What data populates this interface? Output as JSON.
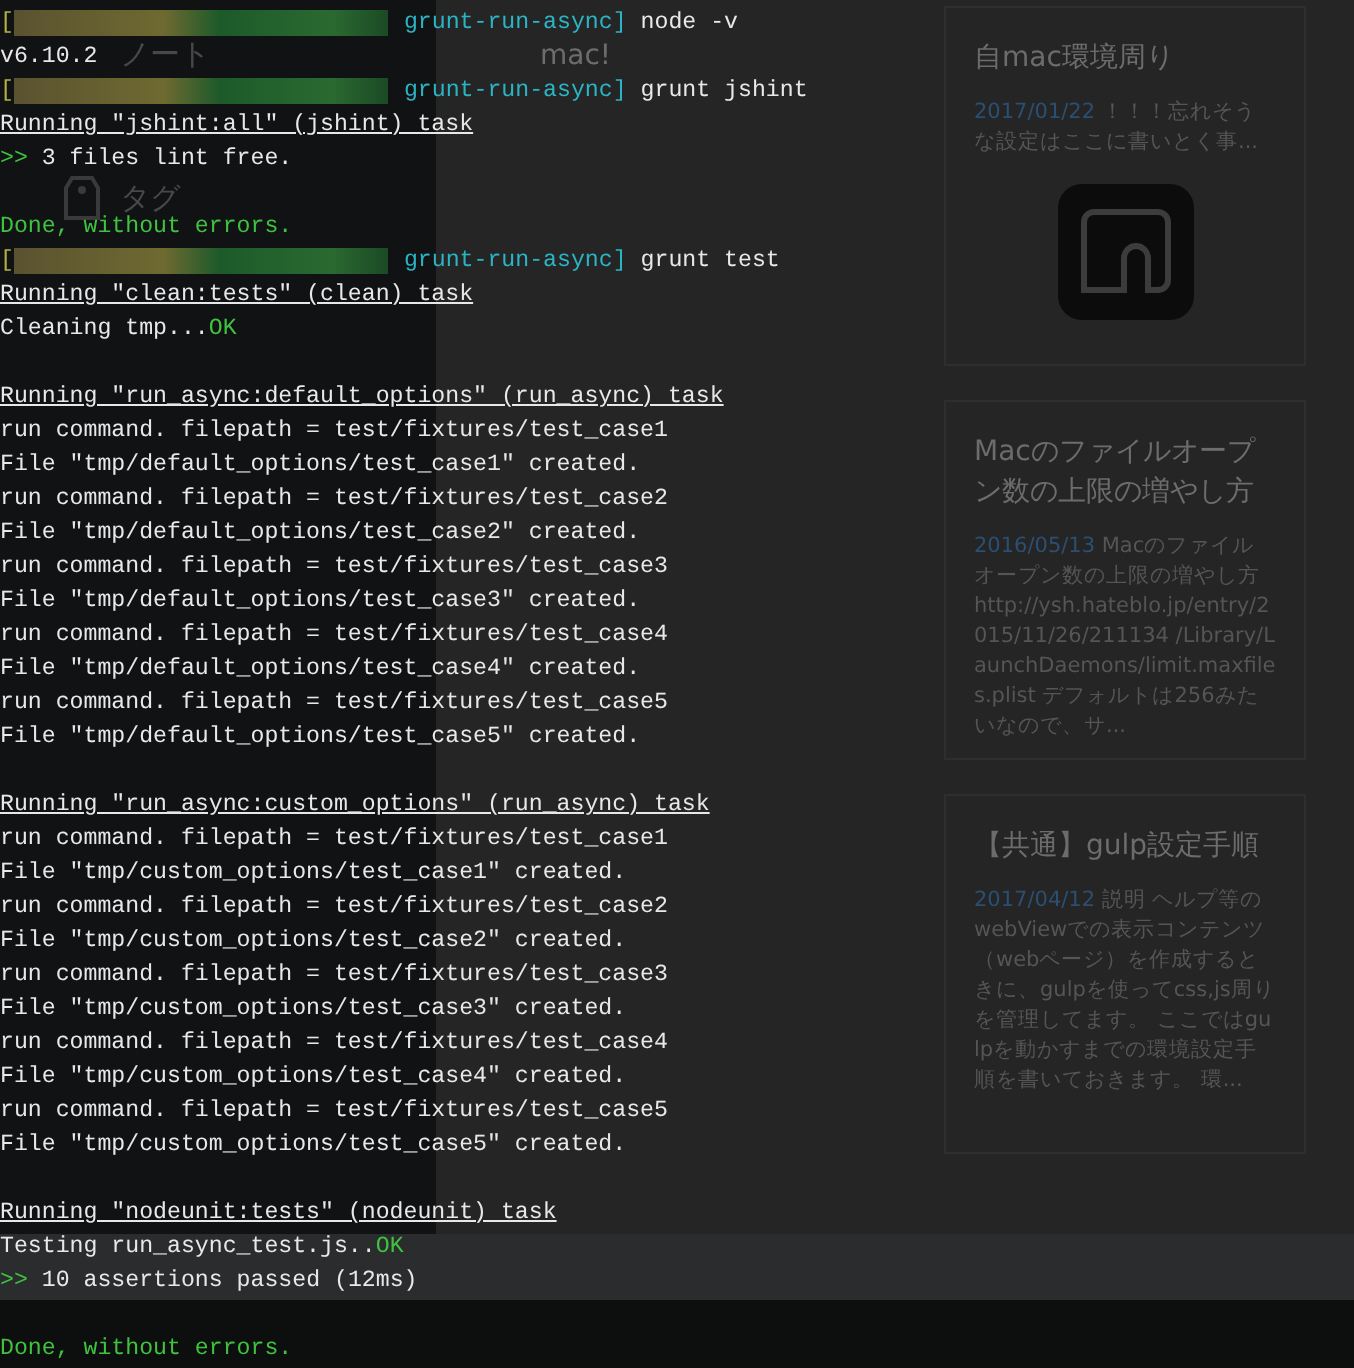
{
  "sidebar": {
    "items": [
      {
        "label": "ノート",
        "kind": "plain"
      },
      {
        "label": "タグ",
        "kind": "tag"
      }
    ]
  },
  "notes": {
    "partial_title": "mac!",
    "cards": [
      {
        "title": "自mac環境周り",
        "date": "2017/01/22",
        "snippet": "！！！忘れそうな設定はここに書いとく事...",
        "kind": "logo"
      },
      {
        "title": "Macのファイルオープン数の上限の増やし方",
        "date": "2016/05/13",
        "snippet": "Macのファイルオープン数の上限の増やし方 http://ysh.hateblo.jp/entry/2015/11/26/211134 /Library/LaunchDaemons/limit.maxfiles.plist デフォルトは256みたいなので、サ...",
        "kind": "text"
      },
      {
        "title": "【共通】gulp設定手順",
        "date": "2017/04/12",
        "snippet": "説明 ヘルプ等のwebViewでの表示コンテンツ（webページ）を作成するときに、gulpを使ってcss,js周りを管理してます。 ここではgulpを動かすまでの環境設定手順を書いておきます。 環...",
        "kind": "text"
      }
    ]
  },
  "terminal": {
    "lines": [
      {
        "kind": "prompt",
        "bracket": "[",
        "directory": "grunt-run-async]",
        "command": "node -v"
      },
      {
        "kind": "output",
        "segments": [
          {
            "text": "v6.10.2"
          }
        ]
      },
      {
        "kind": "prompt",
        "bracket": "[",
        "directory": "grunt-run-async]",
        "command": "grunt jshint"
      },
      {
        "kind": "heading",
        "segments": [
          {
            "text": "Running \"jshint:all\" (jshint) task"
          }
        ]
      },
      {
        "kind": "output",
        "segments": [
          {
            "text": ">>",
            "color": "#3fc23f"
          },
          {
            "text": " 3 files lint free."
          }
        ]
      },
      {
        "kind": "blank"
      },
      {
        "kind": "output",
        "segments": [
          {
            "text": "Done, without errors.",
            "color": "#3fc23f"
          }
        ]
      },
      {
        "kind": "prompt",
        "bracket": "[",
        "directory": "grunt-run-async]",
        "command": "grunt test"
      },
      {
        "kind": "heading",
        "segments": [
          {
            "text": "Running \"clean:tests\" (clean) task"
          }
        ]
      },
      {
        "kind": "output",
        "segments": [
          {
            "text": "Cleaning tmp..."
          },
          {
            "text": "OK",
            "color": "#3fc23f"
          }
        ]
      },
      {
        "kind": "blank"
      },
      {
        "kind": "heading",
        "segments": [
          {
            "text": "Running \"run_async:default_options\" (run_async) task"
          }
        ]
      },
      {
        "kind": "output",
        "segments": [
          {
            "text": "run command. filepath = test/fixtures/test_case1"
          }
        ]
      },
      {
        "kind": "output",
        "segments": [
          {
            "text": "File \"tmp/default_options/test_case1\" created."
          }
        ]
      },
      {
        "kind": "output",
        "segments": [
          {
            "text": "run command. filepath = test/fixtures/test_case2"
          }
        ]
      },
      {
        "kind": "output",
        "segments": [
          {
            "text": "File \"tmp/default_options/test_case2\" created."
          }
        ]
      },
      {
        "kind": "output",
        "segments": [
          {
            "text": "run command. filepath = test/fixtures/test_case3"
          }
        ]
      },
      {
        "kind": "output",
        "segments": [
          {
            "text": "File \"tmp/default_options/test_case3\" created."
          }
        ]
      },
      {
        "kind": "output",
        "segments": [
          {
            "text": "run command. filepath = test/fixtures/test_case4"
          }
        ]
      },
      {
        "kind": "output",
        "segments": [
          {
            "text": "File \"tmp/default_options/test_case4\" created."
          }
        ]
      },
      {
        "kind": "output",
        "segments": [
          {
            "text": "run command. filepath = test/fixtures/test_case5"
          }
        ]
      },
      {
        "kind": "output",
        "segments": [
          {
            "text": "File \"tmp/default_options/test_case5\" created."
          }
        ]
      },
      {
        "kind": "blank"
      },
      {
        "kind": "heading",
        "segments": [
          {
            "text": "Running \"run_async:custom_options\" (run_async) task"
          }
        ]
      },
      {
        "kind": "output",
        "segments": [
          {
            "text": "run command. filepath = test/fixtures/test_case1"
          }
        ]
      },
      {
        "kind": "output",
        "segments": [
          {
            "text": "File \"tmp/custom_options/test_case1\" created."
          }
        ]
      },
      {
        "kind": "output",
        "segments": [
          {
            "text": "run command. filepath = test/fixtures/test_case2"
          }
        ]
      },
      {
        "kind": "output",
        "segments": [
          {
            "text": "File \"tmp/custom_options/test_case2\" created."
          }
        ]
      },
      {
        "kind": "output",
        "segments": [
          {
            "text": "run command. filepath = test/fixtures/test_case3"
          }
        ]
      },
      {
        "kind": "output",
        "segments": [
          {
            "text": "File \"tmp/custom_options/test_case3\" created."
          }
        ]
      },
      {
        "kind": "output",
        "segments": [
          {
            "text": "run command. filepath = test/fixtures/test_case4"
          }
        ]
      },
      {
        "kind": "output",
        "segments": [
          {
            "text": "File \"tmp/custom_options/test_case4\" created."
          }
        ]
      },
      {
        "kind": "output",
        "segments": [
          {
            "text": "run command. filepath = test/fixtures/test_case5"
          }
        ]
      },
      {
        "kind": "output",
        "segments": [
          {
            "text": "File \"tmp/custom_options/test_case5\" created."
          }
        ]
      },
      {
        "kind": "blank"
      },
      {
        "kind": "heading",
        "segments": [
          {
            "text": "Running \"nodeunit:tests\" (nodeunit) task"
          }
        ]
      },
      {
        "kind": "output",
        "segments": [
          {
            "text": "Testing run_async_test.js.."
          },
          {
            "text": "OK",
            "color": "#3fc23f"
          }
        ]
      },
      {
        "kind": "output",
        "segments": [
          {
            "text": ">>",
            "color": "#3fc23f"
          },
          {
            "text": " 10 assertions passed (12ms)"
          }
        ]
      },
      {
        "kind": "blank"
      },
      {
        "kind": "output",
        "segments": [
          {
            "text": "Done, without errors.",
            "color": "#3fc23f"
          }
        ]
      }
    ]
  }
}
